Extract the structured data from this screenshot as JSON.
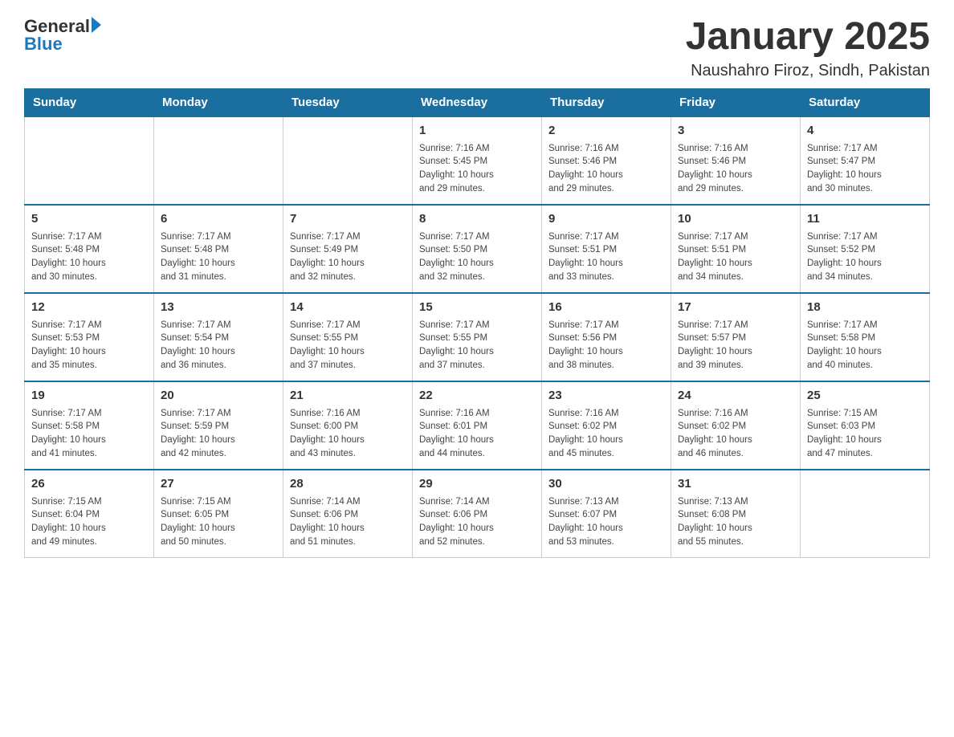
{
  "header": {
    "logo_general": "General",
    "logo_blue": "Blue",
    "month_title": "January 2025",
    "location": "Naushahro Firoz, Sindh, Pakistan"
  },
  "days_of_week": [
    "Sunday",
    "Monday",
    "Tuesday",
    "Wednesday",
    "Thursday",
    "Friday",
    "Saturday"
  ],
  "weeks": [
    [
      {
        "day": "",
        "info": ""
      },
      {
        "day": "",
        "info": ""
      },
      {
        "day": "",
        "info": ""
      },
      {
        "day": "1",
        "info": "Sunrise: 7:16 AM\nSunset: 5:45 PM\nDaylight: 10 hours\nand 29 minutes."
      },
      {
        "day": "2",
        "info": "Sunrise: 7:16 AM\nSunset: 5:46 PM\nDaylight: 10 hours\nand 29 minutes."
      },
      {
        "day": "3",
        "info": "Sunrise: 7:16 AM\nSunset: 5:46 PM\nDaylight: 10 hours\nand 29 minutes."
      },
      {
        "day": "4",
        "info": "Sunrise: 7:17 AM\nSunset: 5:47 PM\nDaylight: 10 hours\nand 30 minutes."
      }
    ],
    [
      {
        "day": "5",
        "info": "Sunrise: 7:17 AM\nSunset: 5:48 PM\nDaylight: 10 hours\nand 30 minutes."
      },
      {
        "day": "6",
        "info": "Sunrise: 7:17 AM\nSunset: 5:48 PM\nDaylight: 10 hours\nand 31 minutes."
      },
      {
        "day": "7",
        "info": "Sunrise: 7:17 AM\nSunset: 5:49 PM\nDaylight: 10 hours\nand 32 minutes."
      },
      {
        "day": "8",
        "info": "Sunrise: 7:17 AM\nSunset: 5:50 PM\nDaylight: 10 hours\nand 32 minutes."
      },
      {
        "day": "9",
        "info": "Sunrise: 7:17 AM\nSunset: 5:51 PM\nDaylight: 10 hours\nand 33 minutes."
      },
      {
        "day": "10",
        "info": "Sunrise: 7:17 AM\nSunset: 5:51 PM\nDaylight: 10 hours\nand 34 minutes."
      },
      {
        "day": "11",
        "info": "Sunrise: 7:17 AM\nSunset: 5:52 PM\nDaylight: 10 hours\nand 34 minutes."
      }
    ],
    [
      {
        "day": "12",
        "info": "Sunrise: 7:17 AM\nSunset: 5:53 PM\nDaylight: 10 hours\nand 35 minutes."
      },
      {
        "day": "13",
        "info": "Sunrise: 7:17 AM\nSunset: 5:54 PM\nDaylight: 10 hours\nand 36 minutes."
      },
      {
        "day": "14",
        "info": "Sunrise: 7:17 AM\nSunset: 5:55 PM\nDaylight: 10 hours\nand 37 minutes."
      },
      {
        "day": "15",
        "info": "Sunrise: 7:17 AM\nSunset: 5:55 PM\nDaylight: 10 hours\nand 37 minutes."
      },
      {
        "day": "16",
        "info": "Sunrise: 7:17 AM\nSunset: 5:56 PM\nDaylight: 10 hours\nand 38 minutes."
      },
      {
        "day": "17",
        "info": "Sunrise: 7:17 AM\nSunset: 5:57 PM\nDaylight: 10 hours\nand 39 minutes."
      },
      {
        "day": "18",
        "info": "Sunrise: 7:17 AM\nSunset: 5:58 PM\nDaylight: 10 hours\nand 40 minutes."
      }
    ],
    [
      {
        "day": "19",
        "info": "Sunrise: 7:17 AM\nSunset: 5:58 PM\nDaylight: 10 hours\nand 41 minutes."
      },
      {
        "day": "20",
        "info": "Sunrise: 7:17 AM\nSunset: 5:59 PM\nDaylight: 10 hours\nand 42 minutes."
      },
      {
        "day": "21",
        "info": "Sunrise: 7:16 AM\nSunset: 6:00 PM\nDaylight: 10 hours\nand 43 minutes."
      },
      {
        "day": "22",
        "info": "Sunrise: 7:16 AM\nSunset: 6:01 PM\nDaylight: 10 hours\nand 44 minutes."
      },
      {
        "day": "23",
        "info": "Sunrise: 7:16 AM\nSunset: 6:02 PM\nDaylight: 10 hours\nand 45 minutes."
      },
      {
        "day": "24",
        "info": "Sunrise: 7:16 AM\nSunset: 6:02 PM\nDaylight: 10 hours\nand 46 minutes."
      },
      {
        "day": "25",
        "info": "Sunrise: 7:15 AM\nSunset: 6:03 PM\nDaylight: 10 hours\nand 47 minutes."
      }
    ],
    [
      {
        "day": "26",
        "info": "Sunrise: 7:15 AM\nSunset: 6:04 PM\nDaylight: 10 hours\nand 49 minutes."
      },
      {
        "day": "27",
        "info": "Sunrise: 7:15 AM\nSunset: 6:05 PM\nDaylight: 10 hours\nand 50 minutes."
      },
      {
        "day": "28",
        "info": "Sunrise: 7:14 AM\nSunset: 6:06 PM\nDaylight: 10 hours\nand 51 minutes."
      },
      {
        "day": "29",
        "info": "Sunrise: 7:14 AM\nSunset: 6:06 PM\nDaylight: 10 hours\nand 52 minutes."
      },
      {
        "day": "30",
        "info": "Sunrise: 7:13 AM\nSunset: 6:07 PM\nDaylight: 10 hours\nand 53 minutes."
      },
      {
        "day": "31",
        "info": "Sunrise: 7:13 AM\nSunset: 6:08 PM\nDaylight: 10 hours\nand 55 minutes."
      },
      {
        "day": "",
        "info": ""
      }
    ]
  ]
}
